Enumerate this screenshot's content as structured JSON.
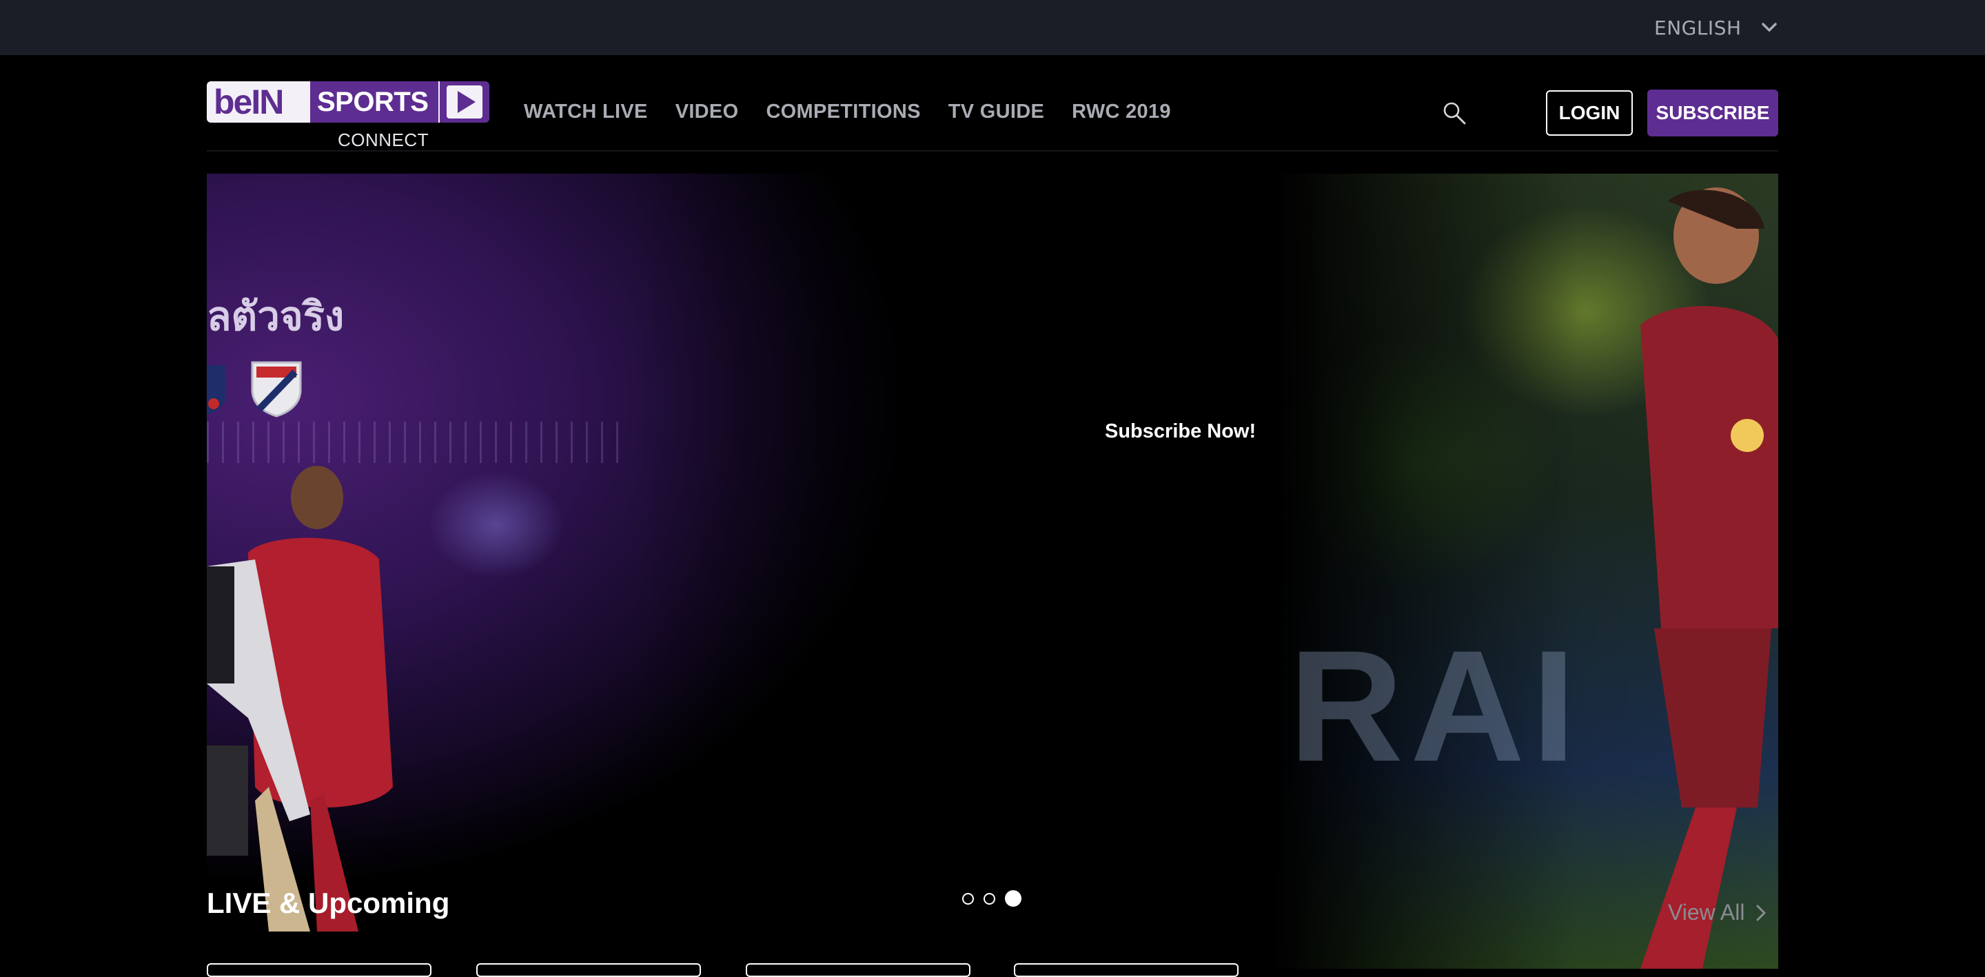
{
  "topbar": {
    "language": "ENGLISH"
  },
  "logo": {
    "brand": "beIN SPORTS",
    "sub": "CONNECT"
  },
  "nav": {
    "items": [
      {
        "label": "WATCH LIVE"
      },
      {
        "label": "VIDEO"
      },
      {
        "label": "COMPETITIONS"
      },
      {
        "label": "TV GUIDE"
      },
      {
        "label": "RWC 2019"
      }
    ]
  },
  "header": {
    "login_label": "LOGIN",
    "subscribe_label": "SUBSCRIBE"
  },
  "hero": {
    "headline_thai": "ลตัวจริง",
    "cta_label": "Subscribe Now!",
    "slide_count": 3,
    "active_slide": 3
  },
  "live_section": {
    "title": "LIVE & Upcoming",
    "view_all_label": "View All"
  },
  "colors": {
    "brand_purple": "#5e2d91",
    "topbar_bg": "#1b1e26",
    "nav_text": "#a9acb3"
  },
  "icons": [
    "chevron-down-icon",
    "search-icon",
    "play-icon",
    "chevron-right-icon"
  ]
}
